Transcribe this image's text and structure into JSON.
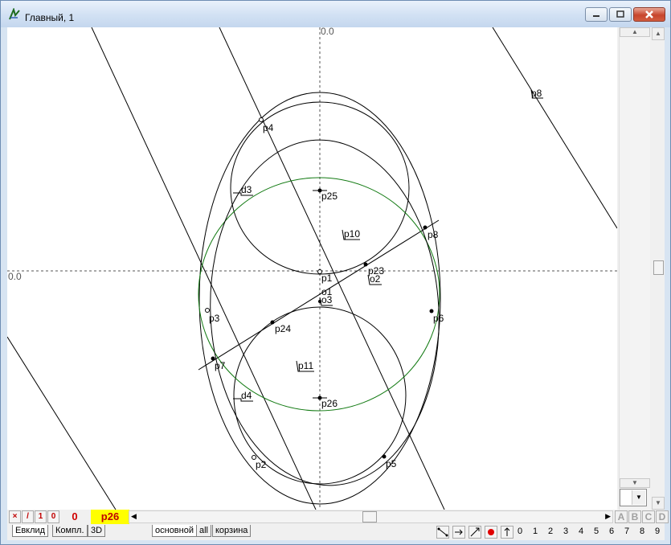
{
  "window": {
    "title": "Главный, 1"
  },
  "canvas": {
    "axis_x_label": "0.0",
    "axis_y_label": "0.0",
    "points": [
      {
        "id": "p1",
        "label": "p1"
      },
      {
        "id": "p2",
        "label": "p2"
      },
      {
        "id": "p3",
        "label": "p3"
      },
      {
        "id": "p4",
        "label": "p4"
      },
      {
        "id": "p5",
        "label": "p5"
      },
      {
        "id": "p6",
        "label": "p6"
      },
      {
        "id": "p7",
        "label": "p7"
      },
      {
        "id": "p8",
        "label": "p8"
      },
      {
        "id": "p10",
        "label": "p10"
      },
      {
        "id": "p11",
        "label": "p11"
      },
      {
        "id": "p23",
        "label": "p23"
      },
      {
        "id": "p24",
        "label": "p24"
      },
      {
        "id": "p25",
        "label": "p25"
      },
      {
        "id": "p26",
        "label": "p26"
      },
      {
        "id": "o1",
        "label": "o1"
      },
      {
        "id": "o2",
        "label": "o2"
      },
      {
        "id": "o3",
        "label": "o3"
      },
      {
        "id": "d3",
        "label": "d3"
      },
      {
        "id": "d4",
        "label": "d4"
      }
    ],
    "colors": {
      "curve": "#000000",
      "green_circle": "#127a12",
      "axis": "#555555"
    }
  },
  "status": {
    "btn_x": "×",
    "btn_slash": "/",
    "btn_one": "1",
    "btn_zero": "0",
    "layer_count": "0",
    "active_point": "p26",
    "letters": [
      "A",
      "B",
      "C",
      "D"
    ]
  },
  "tabs": {
    "left": [
      "Евклид",
      "Компл.",
      "3D"
    ],
    "right": [
      "основной",
      "all",
      "корзина"
    ]
  },
  "tools": [
    "segment-tool",
    "arrow-tool",
    "line-tool",
    "dot-tool",
    "up-tool"
  ],
  "digits": [
    "0",
    "1",
    "2",
    "3",
    "4",
    "5",
    "6",
    "7",
    "8",
    "9"
  ]
}
